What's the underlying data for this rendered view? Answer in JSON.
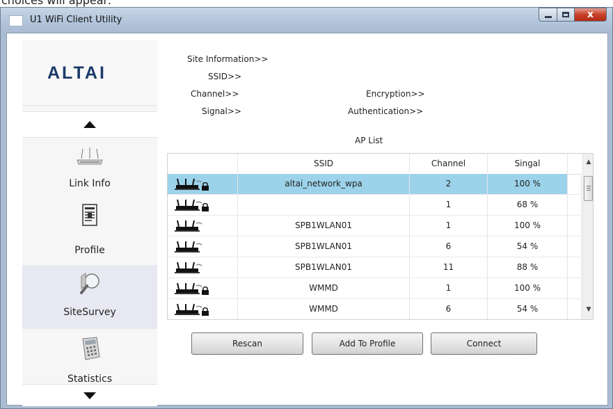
{
  "page_top_caption": "choices will appear:",
  "window": {
    "title": "U1 WiFi Client Utility",
    "close_symbol": "x",
    "controls": [
      "minimize-icon",
      "maximize-icon",
      "close-icon"
    ]
  },
  "logo": "ALTAI",
  "nav": {
    "items": [
      {
        "label": "Link Info",
        "icon": "router-icon"
      },
      {
        "label": "Profile",
        "icon": "document-icon"
      },
      {
        "label": "SiteSurvey",
        "icon": "magnifier-icon",
        "active": true
      },
      {
        "label": "Statistics",
        "icon": "calculator-icon"
      }
    ]
  },
  "site_info": {
    "heading": "Site Information>>",
    "ssid_label": "SSID>>",
    "channel_label": "Channel>>",
    "signal_label": "Signal>>",
    "encryption_label": "Encryption>>",
    "authentication_label": "Authentication>>"
  },
  "ap_list": {
    "title": "AP List",
    "columns": [
      "",
      "SSID",
      "Channel",
      "Singal"
    ],
    "rows": [
      {
        "secured": true,
        "ssid": "altai_network_wpa",
        "channel": "2",
        "signal": "100 %",
        "selected": true
      },
      {
        "secured": true,
        "ssid": "",
        "channel": "1",
        "signal": "68 %"
      },
      {
        "secured": false,
        "ssid": "SPB1WLAN01",
        "channel": "1",
        "signal": "100 %"
      },
      {
        "secured": false,
        "ssid": "SPB1WLAN01",
        "channel": "6",
        "signal": "54 %"
      },
      {
        "secured": false,
        "ssid": "SPB1WLAN01",
        "channel": "11",
        "signal": "88 %"
      },
      {
        "secured": true,
        "ssid": "WMMD",
        "channel": "1",
        "signal": "100 %"
      },
      {
        "secured": true,
        "ssid": "WMMD",
        "channel": "6",
        "signal": "54 %"
      }
    ]
  },
  "buttons": {
    "rescan": "Rescan",
    "add_to_profile": "Add To Profile",
    "connect": "Connect"
  },
  "colors": {
    "selected_row": "#9cd3ea",
    "title_bar": "#b5c7dc",
    "close_button": "#c7402a",
    "logo": "#1b3a6a"
  }
}
